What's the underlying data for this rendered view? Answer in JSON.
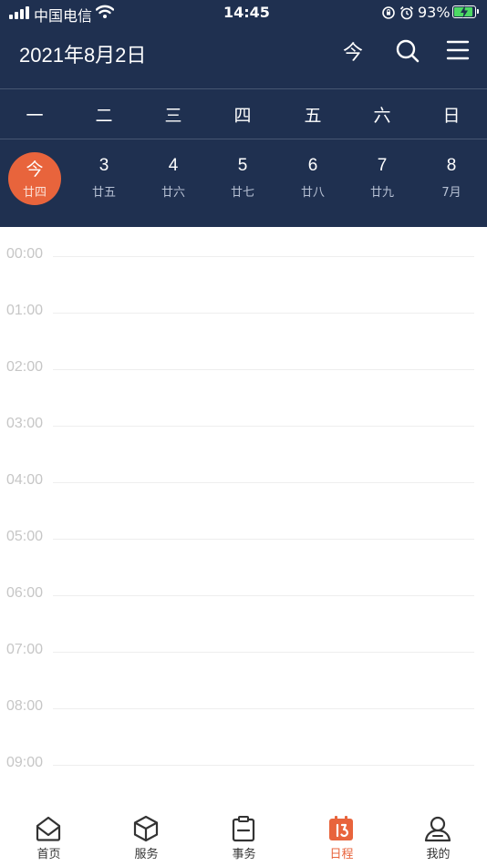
{
  "status_bar": {
    "carrier": "中国电信",
    "time": "14:45",
    "battery_percent": "93%",
    "battery_level": 0.93,
    "icons": [
      "signal-icon",
      "wifi-icon",
      "orientation-lock-icon",
      "alarm-icon",
      "battery-icon"
    ]
  },
  "header": {
    "title": "2021年8月2日",
    "today_label": "今",
    "search_icon": "search-icon",
    "menu_icon": "menu-icon"
  },
  "weekdays": [
    "一",
    "二",
    "三",
    "四",
    "五",
    "六",
    "日"
  ],
  "days": [
    {
      "num": "今",
      "lunar": "廿四",
      "active": true
    },
    {
      "num": "3",
      "lunar": "廿五"
    },
    {
      "num": "4",
      "lunar": "廿六"
    },
    {
      "num": "5",
      "lunar": "廿七"
    },
    {
      "num": "6",
      "lunar": "廿八"
    },
    {
      "num": "7",
      "lunar": "廿九"
    },
    {
      "num": "8",
      "lunar": "7月"
    }
  ],
  "timeline": [
    "00:00",
    "01:00",
    "02:00",
    "03:00",
    "04:00",
    "05:00",
    "06:00",
    "07:00",
    "08:00",
    "09:00"
  ],
  "tabs": [
    {
      "label": "首页",
      "icon": "home-mail-icon"
    },
    {
      "label": "服务",
      "icon": "cube-icon"
    },
    {
      "label": "事务",
      "icon": "clipboard-icon"
    },
    {
      "label": "日程",
      "icon": "calendar-icon",
      "active": true
    },
    {
      "label": "我的",
      "icon": "user-icon"
    }
  ],
  "colors": {
    "header_bg": "#1f3050",
    "accent": "#e8643c",
    "battery_green": "#4cd964"
  }
}
